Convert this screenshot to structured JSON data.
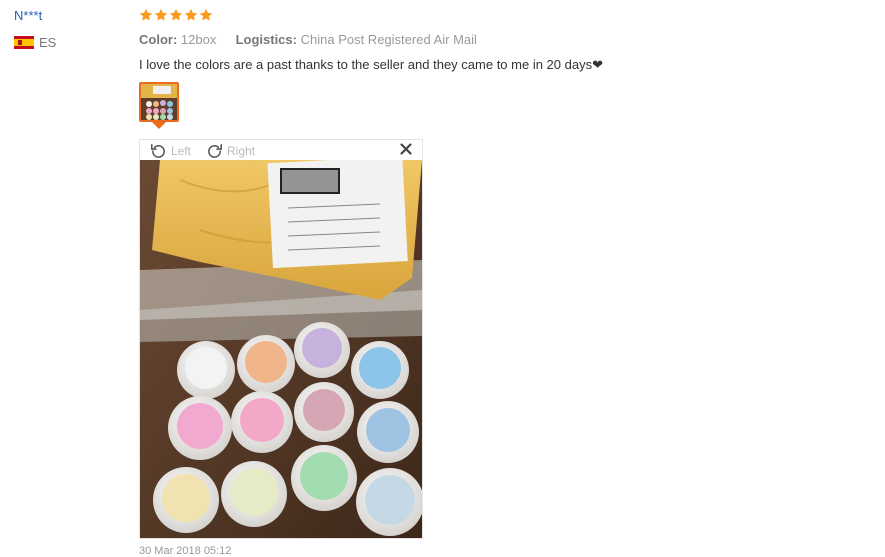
{
  "reviewer": {
    "name": "N***t",
    "country_code": "ES"
  },
  "rating": {
    "stars": 5,
    "color": "#f99a1e"
  },
  "meta": {
    "color_label": "Color:",
    "color_value": "12box",
    "logistics_label": "Logistics:",
    "logistics_value": "China Post Registered Air Mail"
  },
  "review_text": "I love the colors are a past thanks to the seller and they came to me in 20 days❤",
  "viewer": {
    "rotate_left_label": "Left",
    "rotate_right_label": "Right",
    "left_icon": "rotate-left-icon",
    "right_icon": "rotate-right-icon",
    "close_icon": "close-icon"
  },
  "review_date": "30 Mar 2018 05:12"
}
